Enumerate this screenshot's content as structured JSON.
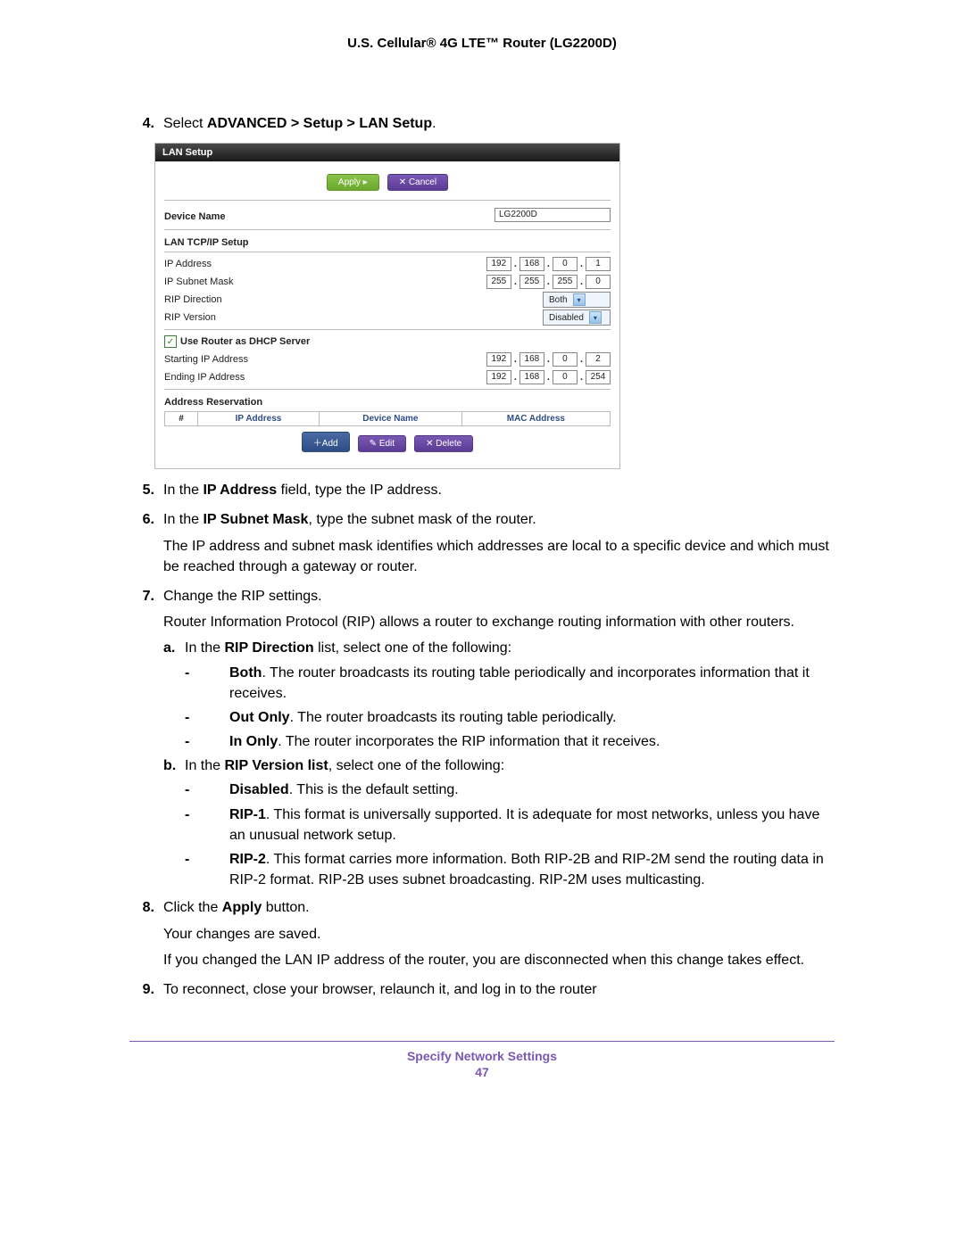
{
  "header": "U.S. Cellular® 4G LTE™ Router (LG2200D)",
  "steps": {
    "s4": {
      "num": "4.",
      "text_pre": "Select ",
      "text_bold": "ADVANCED > Setup > LAN Setup",
      "text_post": "."
    },
    "s5": {
      "num": "5.",
      "pre": "In the ",
      "bold": "IP Address",
      "post": " field, type the IP address."
    },
    "s6": {
      "num": "6.",
      "pre": "In the ",
      "bold": "IP Subnet Mask",
      "post": ", type the subnet mask of the router.",
      "para": "The IP address and subnet mask identifies which addresses are local to a specific device and which must be reached through a gateway or router."
    },
    "s7": {
      "num": "7.",
      "text": "Change the RIP settings.",
      "para": "Router Information Protocol (RIP) allows a router to exchange routing information with other routers.",
      "a": {
        "label": "a.",
        "pre": "In the ",
        "bold": "RIP Direction",
        "post": " list, select one of the following:",
        "items": [
          {
            "bold": "Both",
            "text": ". The router broadcasts its routing table periodically and incorporates information that it receives."
          },
          {
            "bold": "Out Only",
            "text": ". The router broadcasts its routing table periodically."
          },
          {
            "bold": "In Only",
            "text": ". The router incorporates the RIP information that it receives."
          }
        ]
      },
      "b": {
        "label": "b.",
        "pre": "In the ",
        "bold": "RIP Version list",
        "post": ", select one of the following:",
        "items": [
          {
            "bold": "Disabled",
            "text": ". This is the default setting."
          },
          {
            "bold": "RIP-1",
            "text": ". This format is universally supported. It is adequate for most networks, unless you have an unusual network setup."
          },
          {
            "bold": "RIP-2",
            "text": ". This format carries more information. Both RIP-2B and RIP-2M send the routing data in RIP-2 format. RIP-2B uses subnet broadcasting. RIP-2M uses multicasting."
          }
        ]
      }
    },
    "s8": {
      "num": "8.",
      "pre": "Click the ",
      "bold": "Apply",
      "post": " button.",
      "para1": "Your changes are saved.",
      "para2": "If you changed the LAN IP address of the router, you are disconnected when this change takes effect."
    },
    "s9": {
      "num": "9.",
      "text": "To reconnect, close your browser, relaunch it, and log in to the router"
    }
  },
  "panel": {
    "title": "LAN Setup",
    "apply": "Apply ▸",
    "cancel": "✕ Cancel",
    "device_name_label": "Device Name",
    "device_name_value": "LG2200D",
    "lan_tcpip_label": "LAN TCP/IP Setup",
    "ip_address_label": "IP Address",
    "ip": [
      "192",
      "168",
      "0",
      "1"
    ],
    "subnet_label": "IP Subnet Mask",
    "subnet": [
      "255",
      "255",
      "255",
      "0"
    ],
    "rip_dir_label": "RIP Direction",
    "rip_dir_value": "Both",
    "rip_ver_label": "RIP Version",
    "rip_ver_value": "Disabled",
    "dhcp_label": "Use Router as DHCP Server",
    "start_ip_label": "Starting IP Address",
    "start_ip": [
      "192",
      "168",
      "0",
      "2"
    ],
    "end_ip_label": "Ending IP Address",
    "end_ip": [
      "192",
      "168",
      "0",
      "254"
    ],
    "reservation_label": "Address Reservation",
    "th_num": "#",
    "th_ip": "IP Address",
    "th_dev": "Device Name",
    "th_mac": "MAC Address",
    "add": "＋Add",
    "edit": "✎ Edit",
    "delete": "✕ Delete"
  },
  "footer": {
    "section": "Specify Network Settings",
    "page": "47"
  }
}
